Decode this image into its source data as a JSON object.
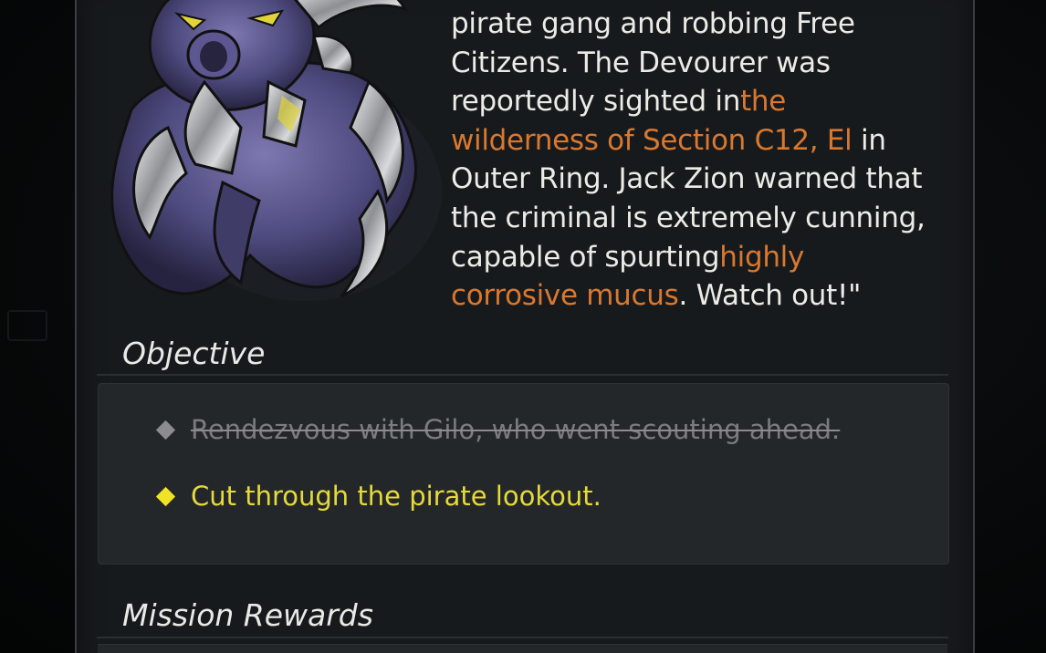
{
  "description": {
    "line1": "pirate gang and robbing Free",
    "line2": "Citizens. The Devourer was",
    "line3a": "reportedly sighted in",
    "line3b": "the",
    "line4a": "wilderness of Section C12, El",
    "line4b": " in",
    "line5": "Outer Ring. Jack Zion warned that",
    "line6": "the criminal is extremely cunning,",
    "line7a": "capable of spurting",
    "line7b": "highly",
    "line8a": "corrosive mucus",
    "line8b": ". Watch out!\""
  },
  "objective": {
    "title": "Objective",
    "items": [
      {
        "text": "Rendezvous with Gilo, who went scouting ahead.",
        "status": "completed"
      },
      {
        "text": "Cut through the pirate lookout.",
        "status": "active"
      }
    ]
  },
  "rewards": {
    "title": "Mission Rewards"
  },
  "colors": {
    "highlight": "#d9782f",
    "active_objective": "#f0e224",
    "completed_objective": "#7a7c7d",
    "panel": "#171a1d"
  },
  "icons": {
    "portrait": "devourer-creature-portrait",
    "objective_marker": "diamond-icon"
  }
}
